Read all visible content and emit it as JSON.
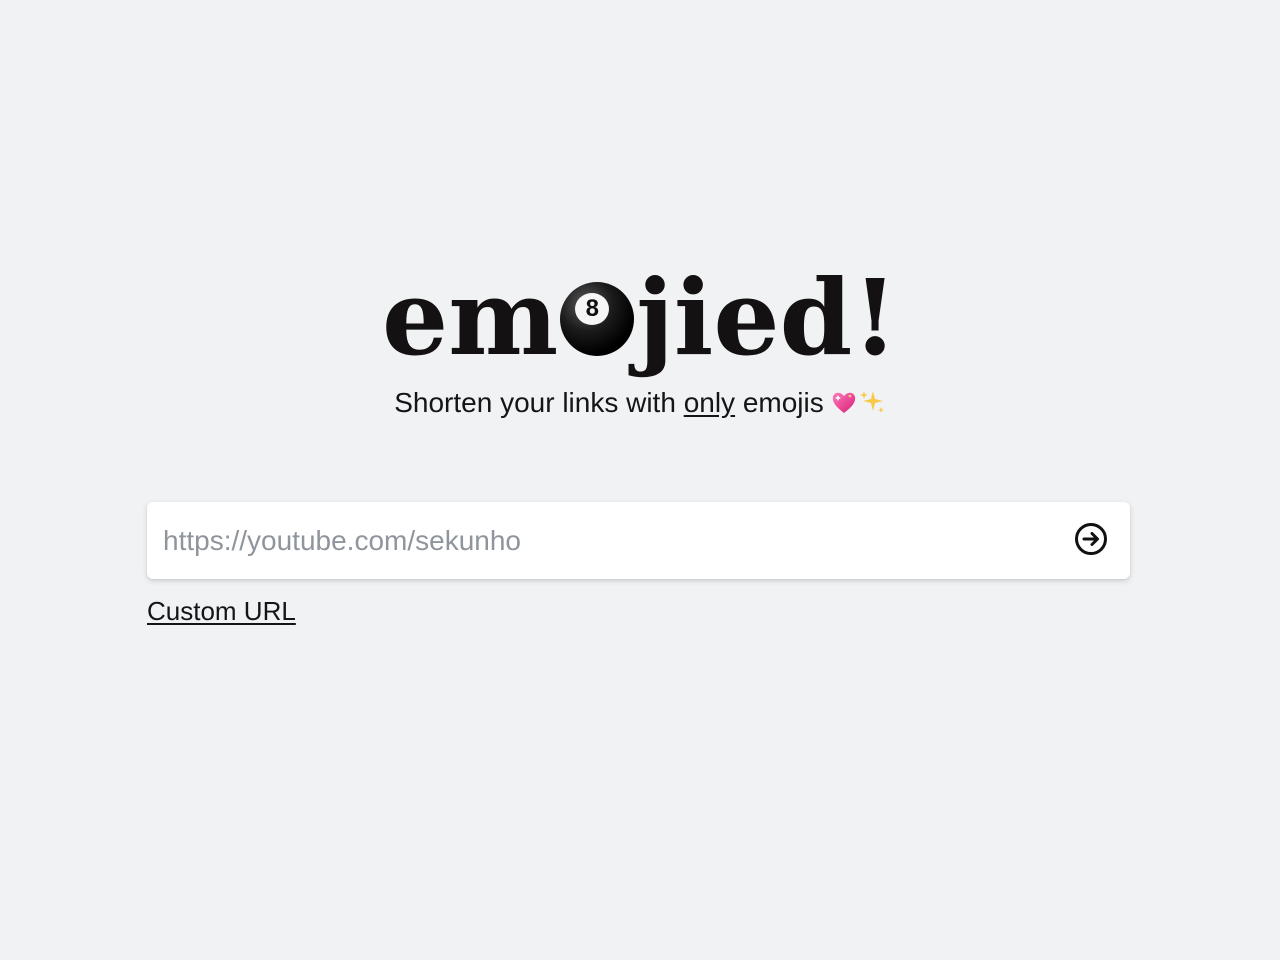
{
  "logo": {
    "prefix": "em",
    "ball_number": "8",
    "suffix": "jied!",
    "ball_icon": "8-ball-icon"
  },
  "tagline": {
    "before": "Shorten your links with ",
    "emphasis": "only",
    "after": " emojis",
    "emoji_icons": [
      "sparkling-heart-icon",
      "sparkles-icon"
    ]
  },
  "url_form": {
    "placeholder": "https://youtube.com/sekunho",
    "value": "",
    "submit_icon": "arrow-right-circle-icon"
  },
  "custom_url_link": "Custom URL",
  "colors": {
    "background": "#f0f2f4",
    "text": "#141112",
    "placeholder": "#8f959c",
    "input_bg": "#ffffff"
  }
}
